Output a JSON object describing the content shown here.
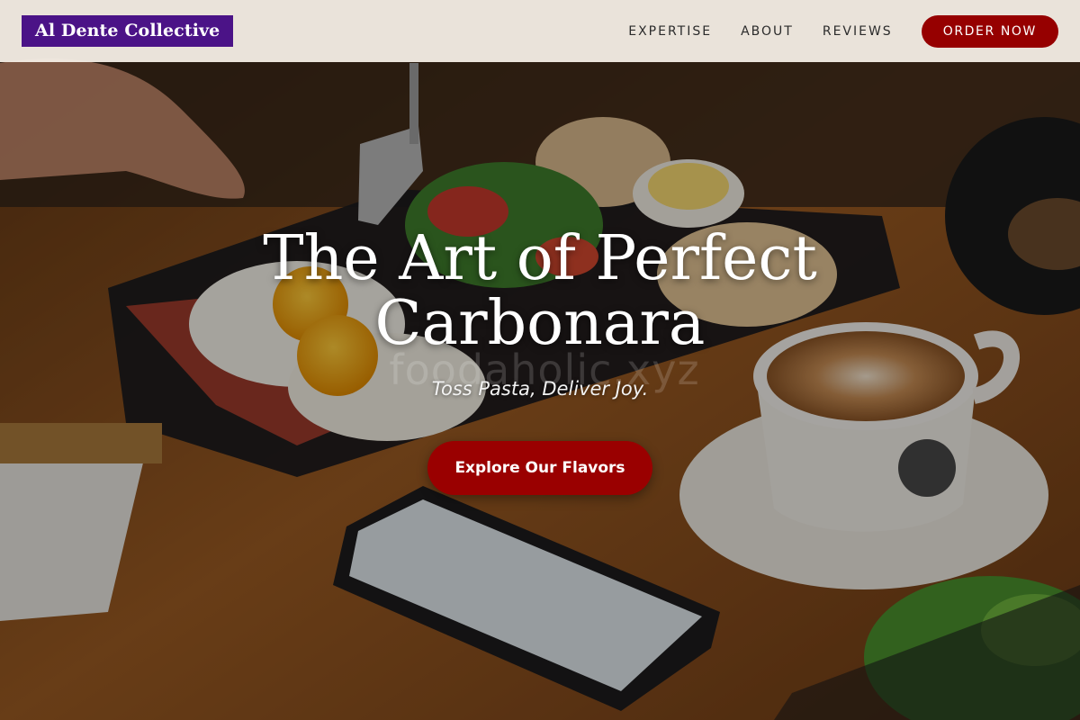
{
  "brand": {
    "name": "Al Dente Collective"
  },
  "nav": {
    "links": [
      "EXPERTISE",
      "ABOUT",
      "REVIEWS"
    ],
    "order_label": "ORDER NOW"
  },
  "hero": {
    "title_line1": "The Art of Perfect",
    "title_line2": "Carbonara",
    "watermark": "foodaholic.xyz",
    "subtitle": "Toss Pasta, Deliver Joy.",
    "cta_label": "Explore Our Flavors"
  },
  "colors": {
    "brand_bg": "#4b1387",
    "accent": "#960000",
    "header_bg": "#f4eee6"
  },
  "icons": []
}
